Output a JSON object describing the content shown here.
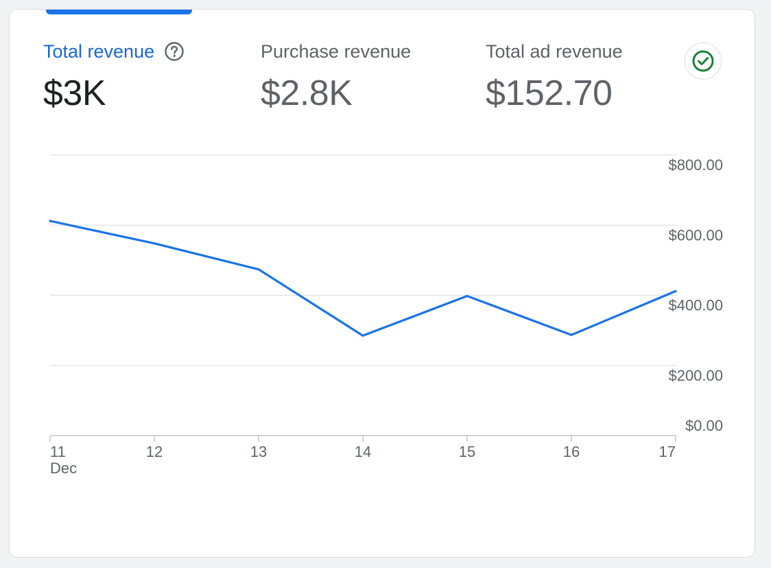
{
  "metrics": [
    {
      "label": "Total revenue",
      "value": "$3K"
    },
    {
      "label": "Purchase revenue",
      "value": "$2.8K"
    },
    {
      "label": "Total ad revenue",
      "value": "$152.70"
    }
  ],
  "icons": {
    "help": "help-circle-icon",
    "check": "check-circle-icon"
  },
  "colors": {
    "accent": "#1a73e8",
    "active_label": "#1967d2",
    "check": "#188038",
    "gridline": "#e0e0e0",
    "text_secondary": "#5f6368"
  },
  "chart_data": {
    "type": "line",
    "x": [
      "11",
      "12",
      "13",
      "14",
      "15",
      "16",
      "17"
    ],
    "x_sublabel": {
      "11": "Dec"
    },
    "series": [
      {
        "values": [
          612,
          548,
          474,
          285,
          398,
          287,
          412
        ]
      }
    ],
    "y_ticks": [
      "$800.00",
      "$600.00",
      "$400.00",
      "$200.00",
      "$0.00"
    ],
    "y_tick_values": [
      800,
      600,
      400,
      200,
      0
    ],
    "ylim": [
      0,
      800
    ],
    "grid": true,
    "y_axis_position": "right"
  }
}
